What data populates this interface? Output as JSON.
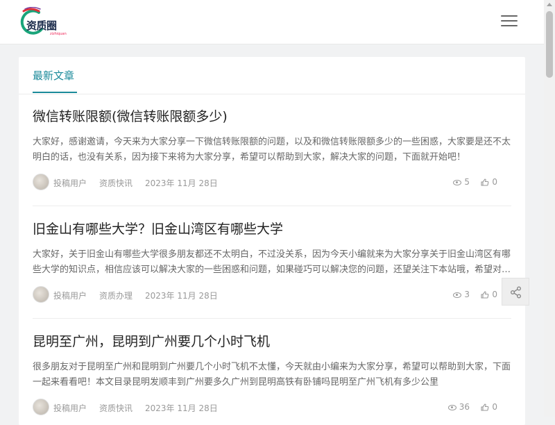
{
  "logo": {
    "text": "资质圈",
    "tagline": "zizhiquan"
  },
  "section": {
    "title": "最新文章"
  },
  "posts": [
    {
      "title": "微信转账限额(微信转账限额多少)",
      "excerpt": "大家好，感谢邀请，今天来为大家分享一下微信转账限额的问题，以及和微信转账限额多少的一些困惑，大家要是还不太明白的话，也没有关系，因为接下来将为大家分享，希望可以帮助到大家，解决大家的问题，下面就开始吧！",
      "author": "投稿用户",
      "category": "资质快讯",
      "date": "2023年 11月 28日",
      "views": "5",
      "likes": "0"
    },
    {
      "title": "旧金山有哪些大学？旧金山湾区有哪些大学",
      "excerpt": "大家好，关于旧金山有哪些大学很多朋友都还不太明白，不过没关系，因为今天小编就来为大家分享关于旧金山湾区有哪些大学的知识点，相信应该可以解决大家的一些困惑和问题，如果碰巧可以解决您的问题，还望关注下本站哦，希望对各位有所帮助！",
      "author": "投稿用户",
      "category": "资质办理",
      "date": "2023年 11月 28日",
      "views": "3",
      "likes": "0"
    },
    {
      "title": "昆明至广州，昆明到广州要几个小时飞机",
      "excerpt": "很多朋友对于昆明至广州和昆明到广州要几个小时飞机不太懂，今天就由小编来为大家分享，希望可以帮助到大家，下面一起来看看吧！本文目录昆明发顺丰到广州要多久广州到昆明高铁有卧铺吗昆明至广州飞机有多少公里",
      "author": "投稿用户",
      "category": "资质快讯",
      "date": "2023年 11月 28日",
      "views": "36",
      "likes": "0"
    }
  ]
}
